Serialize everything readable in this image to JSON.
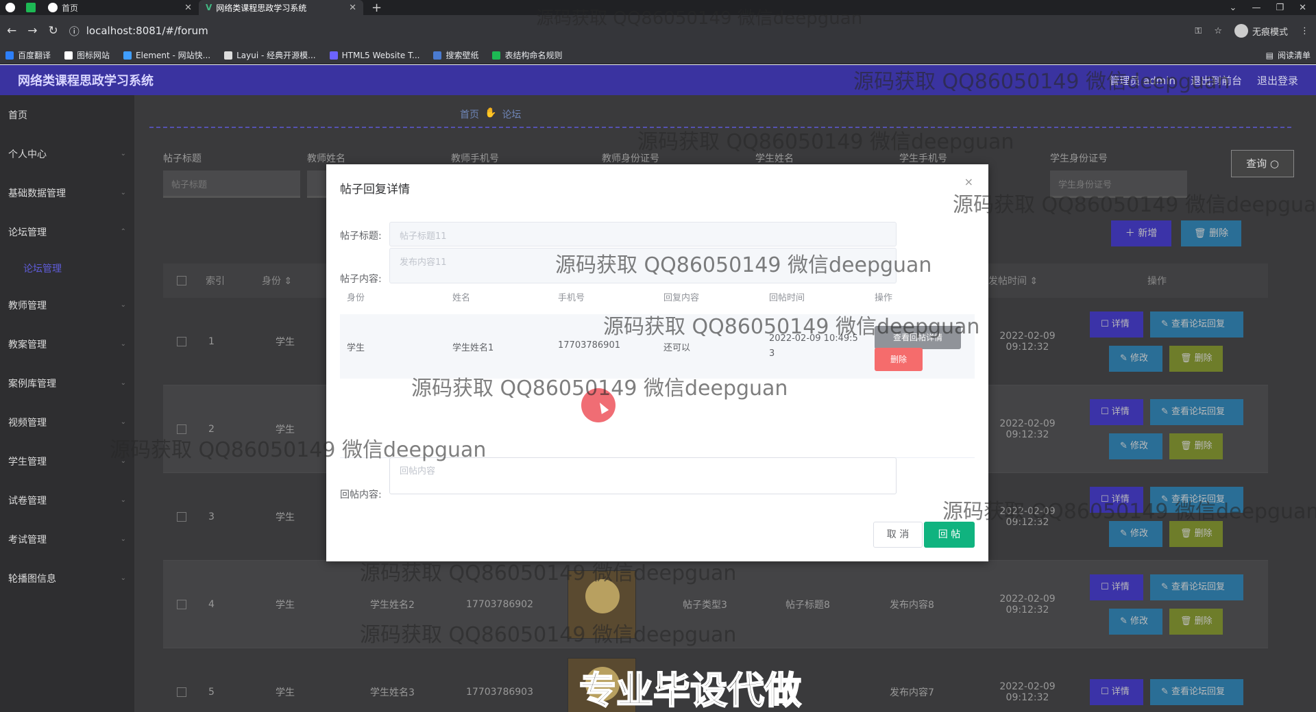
{
  "browser": {
    "tabs": [
      {
        "label": "首页"
      },
      {
        "label": "网络类课程思政学习系统"
      }
    ],
    "url": "localhost:8081/#/forum",
    "incognito_label": "无痕模式",
    "bookmarks": [
      "百度翻译",
      "图标网站",
      "Element - 网站快...",
      "Layui - 经典开源模...",
      "HTML5 Website T...",
      "搜索壁纸",
      "表结构命名规则"
    ],
    "reading_list": "阅读清单"
  },
  "header": {
    "title": "网络类课程思政学习系统",
    "right": [
      "管理员 admin",
      "退出到前台",
      "退出登录"
    ]
  },
  "sidebar": {
    "items": [
      {
        "label": "首页"
      },
      {
        "label": "个人中心"
      },
      {
        "label": "基础数据管理"
      },
      {
        "label": "论坛管理"
      },
      {
        "label": "教师管理"
      },
      {
        "label": "教案管理"
      },
      {
        "label": "案例库管理"
      },
      {
        "label": "视频管理"
      },
      {
        "label": "学生管理"
      },
      {
        "label": "试卷管理"
      },
      {
        "label": "考试管理"
      },
      {
        "label": "轮播图信息"
      }
    ],
    "active_sub": "论坛管理"
  },
  "breadcrumb": {
    "home": "首页",
    "current": "论坛"
  },
  "filters": {
    "labels": [
      "帖子标题",
      "教师姓名",
      "教师手机号",
      "教师身份证号",
      "学生姓名",
      "学生手机号",
      "学生身份证号"
    ],
    "placeholder_title": "帖子标题",
    "placeholder_student_id": "学生身份证号",
    "query_button": "查询 ○",
    "add_button": "＋ 新增",
    "delete_button": "🗑 删除"
  },
  "table": {
    "headers": {
      "index": "索引",
      "identity": "身份 ⇕",
      "time": "发帖时间 ⇕",
      "ops": "操作"
    },
    "rows": [
      {
        "index": "1",
        "identity": "学生",
        "name": "",
        "phone": "",
        "type": "",
        "title": "",
        "content": "",
        "time": "2022-02-09 09:12:32"
      },
      {
        "index": "2",
        "identity": "学生",
        "name": "",
        "phone": "",
        "type": "",
        "title": "",
        "content": "",
        "time": "2022-02-09 09:12:32"
      },
      {
        "index": "3",
        "identity": "学生",
        "name": "",
        "phone": "",
        "type": "",
        "title": "",
        "content": "",
        "time": "2022-02-09 09:12:32"
      },
      {
        "index": "4",
        "identity": "学生",
        "name": "学生姓名2",
        "phone": "17703786902",
        "type": "帖子类型3",
        "title": "帖子标题8",
        "content": "发布内容8",
        "time": "2022-02-09 09:12:32"
      },
      {
        "index": "5",
        "identity": "学生",
        "name": "学生姓名3",
        "phone": "17703786903",
        "type": "",
        "title": "",
        "content": "发布内容7",
        "time": "2022-02-09 09:12:32"
      }
    ],
    "op_labels": {
      "detail": "☐ 详情",
      "reply": "✎ 查看论坛回复",
      "edit": "✎ 修改",
      "del": "🗑 删除"
    }
  },
  "modal": {
    "title": "帖子回复详情",
    "close": "×",
    "post_title_label": "帖子标题:",
    "post_title_value": "帖子标题11",
    "post_content_label": "帖子内容:",
    "post_content_value": "发布内容11",
    "reply_headers": [
      "身份",
      "姓名",
      "手机号",
      "回复内容",
      "回帖时间",
      "操作"
    ],
    "reply_rows": [
      {
        "identity": "学生",
        "name": "学生姓名1",
        "phone": "17703786901",
        "content": "还可以",
        "time_line1": "2022-02-09 10:49:5",
        "time_line2": "3"
      }
    ],
    "view_detail_button": "查看回帖详情",
    "row_delete_button": "删除",
    "reply_label": "回帖内容:",
    "reply_placeholder": "回帖内容",
    "cancel_button": "取 消",
    "submit_button": "回 帖"
  },
  "watermark": "源码获取 QQ86050149 微信deepguan",
  "banner": "专业毕设代做"
}
